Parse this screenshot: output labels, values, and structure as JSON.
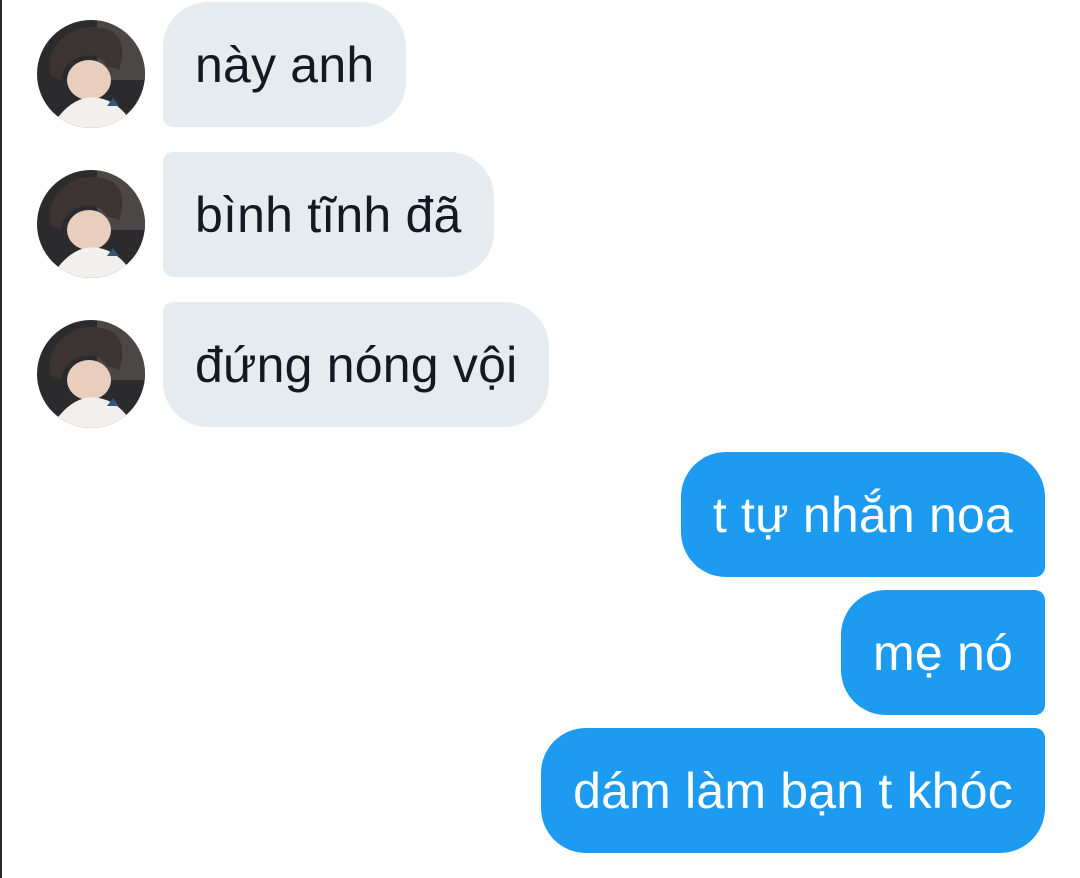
{
  "conversation": {
    "received": [
      {
        "text": "này anh"
      },
      {
        "text": "bình tĩnh đã"
      },
      {
        "text": "đứng nóng vội"
      }
    ],
    "sent": [
      {
        "text": "t tự nhắn noa"
      },
      {
        "text": "mẹ nó"
      },
      {
        "text": "dám làm bạn t khóc"
      }
    ]
  },
  "colors": {
    "received_bubble": "#e6ebef",
    "received_text": "#141823",
    "sent_bubble": "#1d9bf0",
    "sent_text": "#ffffff"
  },
  "icons": {
    "avatar": "profile-photo-avatar"
  }
}
